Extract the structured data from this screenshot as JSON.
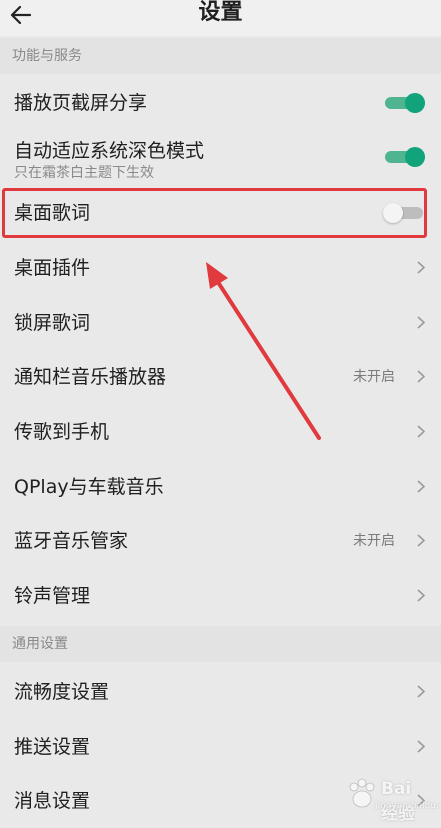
{
  "header": {
    "title": "设置",
    "back_icon": "arrow-left-icon"
  },
  "sections": [
    {
      "header": "功能与服务",
      "items": [
        {
          "label": "播放页截屏分享",
          "control": "toggle",
          "on": true
        },
        {
          "label": "自动适应系统深色模式",
          "sublabel": "只在霜茶白主题下生效",
          "control": "toggle",
          "on": true
        },
        {
          "label": "桌面歌词",
          "control": "toggle",
          "on": false
        },
        {
          "label": "桌面插件",
          "control": "chevron"
        },
        {
          "label": "锁屏歌词",
          "control": "chevron"
        },
        {
          "label": "通知栏音乐播放器",
          "status": "未开启",
          "control": "chevron"
        },
        {
          "label": "传歌到手机",
          "control": "chevron"
        },
        {
          "label": "QPlay与车载音乐",
          "control": "chevron"
        },
        {
          "label": "蓝牙音乐管家",
          "status": "未开启",
          "control": "chevron"
        },
        {
          "label": "铃声管理",
          "control": "chevron"
        }
      ]
    },
    {
      "header": "通用设置",
      "items": [
        {
          "label": "流畅度设置",
          "control": "chevron"
        },
        {
          "label": "推送设置",
          "control": "chevron"
        },
        {
          "label": "消息设置",
          "control": "chevron"
        }
      ]
    }
  ],
  "annotation": {
    "highlight_color": "#e0393e"
  },
  "watermark": {
    "text": "Bai 经验",
    "url": "jingyan.baidu.com"
  },
  "colors": {
    "toggle_on": "#11a37a",
    "toggle_off": "#bdbdbd",
    "background": "#e9e9e9"
  }
}
